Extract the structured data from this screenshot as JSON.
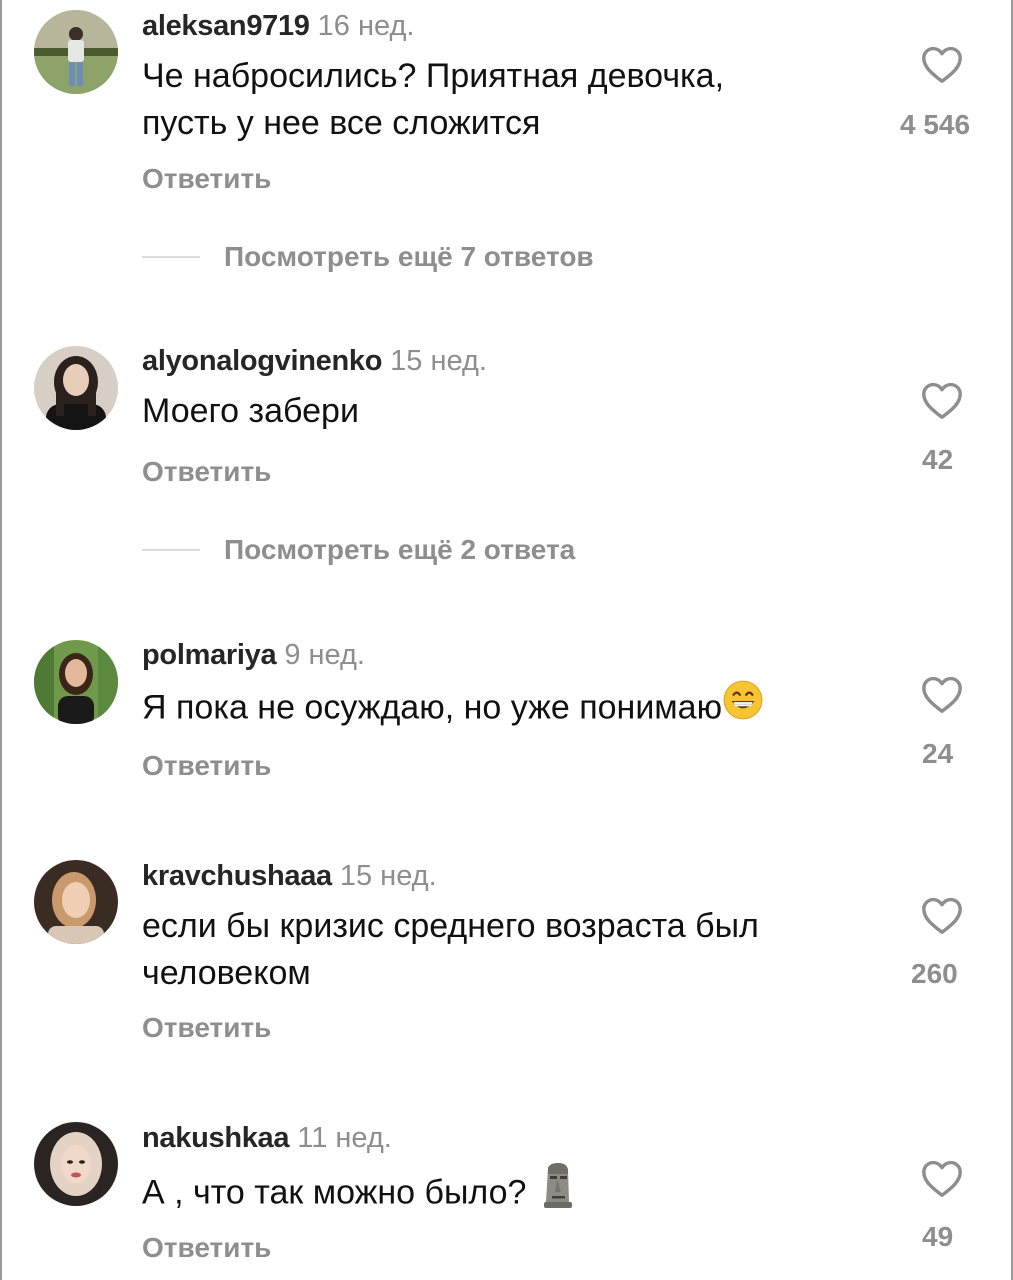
{
  "comments": [
    {
      "username": "aleksan9719",
      "time": "16 нед.",
      "text_lines": [
        "Че набросились? Приятная девочка,",
        "пусть у нее все сложится"
      ],
      "reply_label": "Ответить",
      "likes": "4 546",
      "more_replies": "Посмотреть ещё 7 ответов"
    },
    {
      "username": "alyonalogvinenko",
      "time": "15 нед.",
      "text_lines": [
        "Моего забери"
      ],
      "reply_label": "Ответить",
      "likes": "42",
      "more_replies": "Посмотреть ещё 2 ответа"
    },
    {
      "username": "polmariya",
      "time": "9 нед.",
      "text_lines": [
        "Я пока не осуждаю, но уже понимаю"
      ],
      "emoji": "grinning-face-emoji",
      "reply_label": "Ответить",
      "likes": "24"
    },
    {
      "username": "kravchushaaa",
      "time": "15 нед.",
      "text_lines": [
        "если бы кризис среднего возраста был",
        "человеком"
      ],
      "reply_label": "Ответить",
      "likes": "260"
    },
    {
      "username": "nakushkaa",
      "time": "11 нед.",
      "text_lines": [
        "А , что так можно было?"
      ],
      "emoji": "moai-emoji",
      "reply_label": "Ответить",
      "likes": "49"
    }
  ],
  "icons": {
    "like": "heart-outline-icon"
  },
  "colors": {
    "text": "#111111",
    "secondary": "#8e8e8e",
    "username": "#262626",
    "divider": "#dbdbdb",
    "background": "#ffffff"
  }
}
